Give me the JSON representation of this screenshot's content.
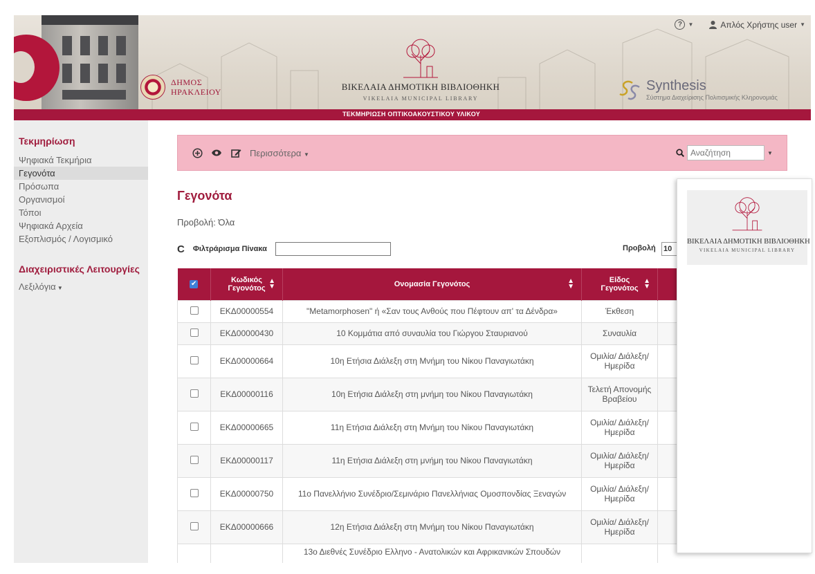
{
  "header": {
    "help_label": "",
    "user_label": "Απλός Χρήστης user",
    "dimos_line1": "ΔΗΜΟΣ",
    "dimos_line2": "ΗΡΑΚΛΕΙΟΥ",
    "library_name": "ΒΙΚΕΛΑΙΑ ΔΗΜΟΤΙΚΗ ΒΙΒΛΙΟΘΗΚΗ",
    "library_sub": "VIKELAIA MUNICIPAL LIBRARY",
    "brand": "Synthesis",
    "brand_slogan": "Σύστημα Διαχείρισης Πολιτισμικής Κληρονομιάς",
    "banner_label": "ΤΕΚΜΗΡΙΩΣΗ ΟΠΤΙΚΟΑΚΟΥΣΤΙΚΟΥ ΥΛΙΚΟΥ"
  },
  "sidebar": {
    "section1_title": "Τεκμηρίωση",
    "items": [
      {
        "label": "Ψηφιακά Τεκμήρια",
        "active": false
      },
      {
        "label": "Γεγονότα",
        "active": true
      },
      {
        "label": "Πρόσωπα",
        "active": false
      },
      {
        "label": "Οργανισμοί",
        "active": false
      },
      {
        "label": "Τόποι",
        "active": false
      },
      {
        "label": "Ψηφιακά Αρχεία",
        "active": false
      },
      {
        "label": "Εξοπλισμός / Λογισμικό",
        "active": false
      }
    ],
    "section2_title": "Διαχειριστικές Λειτουργίες",
    "lexilogia": "Λεξιλόγια"
  },
  "toolbar": {
    "more_label": "Περισσότερα",
    "search_placeholder": "Αναζήτηση"
  },
  "main": {
    "title": "Γεγονότα",
    "view_label": "Προβολή: Όλα",
    "filter_label": "Φιλτράρισμα Πίνακα",
    "show_label": "Προβολή",
    "show_value": "10"
  },
  "table": {
    "headers": [
      "Κωδικός Γεγονότος",
      "Ονομασία Γεγονότος",
      "Είδος Γεγονότος"
    ],
    "rows": [
      {
        "code": "ΕΚΔ00000554",
        "name": "\"Metamorphosen\" ή «Σαν τους Ανθούς που Πέφτουν απ' τα Δένδρα»",
        "type": "Έκθεση"
      },
      {
        "code": "ΕΚΔ00000430",
        "name": "10 Κομμάτια από συναυλία του Γιώργου Σταυριανού",
        "type": "Συναυλία"
      },
      {
        "code": "ΕΚΔ00000664",
        "name": "10η Ετήσια Διάλεξη στη Μνήμη του Νίκου Παναγιωτάκη",
        "type": "Ομιλία/ Διάλεξη/ Ημερίδα"
      },
      {
        "code": "ΕΚΔ00000116",
        "name": "10η Ετήσια Διάλεξη στη μνήμη του Νίκου Παναγιωτάκη",
        "type": "Τελετή Απονομής Βραβείου"
      },
      {
        "code": "ΕΚΔ00000665",
        "name": "11η Ετήσια Διάλεξη στη Μνήμη του Νίκου Παναγιωτάκη",
        "type": "Ομιλία/ Διάλεξη/ Ημερίδα"
      },
      {
        "code": "ΕΚΔ00000117",
        "name": "11η Ετήσια Διάλεξη στη μνήμη του Νίκου Παναγιωτάκη",
        "type": "Ομιλία/ Διάλεξη/ Ημερίδα"
      },
      {
        "code": "ΕΚΔ00000750",
        "name": "11ο Πανελλήνιο Συνέδριο/Σεμινάριο Πανελλήνιας Ομοσπονδίας Ξεναγών",
        "type": "Ομιλία/ Διάλεξη/ Ημερίδα"
      },
      {
        "code": "ΕΚΔ00000666",
        "name": "12η Ετήσια Διάλεξη στη Μνήμη του Νίκου Παναγιωτάκη",
        "type": "Ομιλία/ Διάλεξη/ Ημερίδα"
      },
      {
        "code": "",
        "name": "13ο Διεθνές Συνέδριο Ελληνο - Ανατολικών και Αφρικανικών Σπουδών",
        "type": ""
      }
    ]
  },
  "popover": {
    "name": "ΒΙΚΕΛΑΙΑ ΔΗΜΟΤΙΚΗ ΒΙΒΛΙΟΘΗΚΗ",
    "sub": "VIKELAIA MUNICIPAL LIBRARY"
  },
  "colors": {
    "accent": "#a5173d",
    "toolbar_bg": "#f4b7c5",
    "sidebar_bg": "#ededed"
  }
}
